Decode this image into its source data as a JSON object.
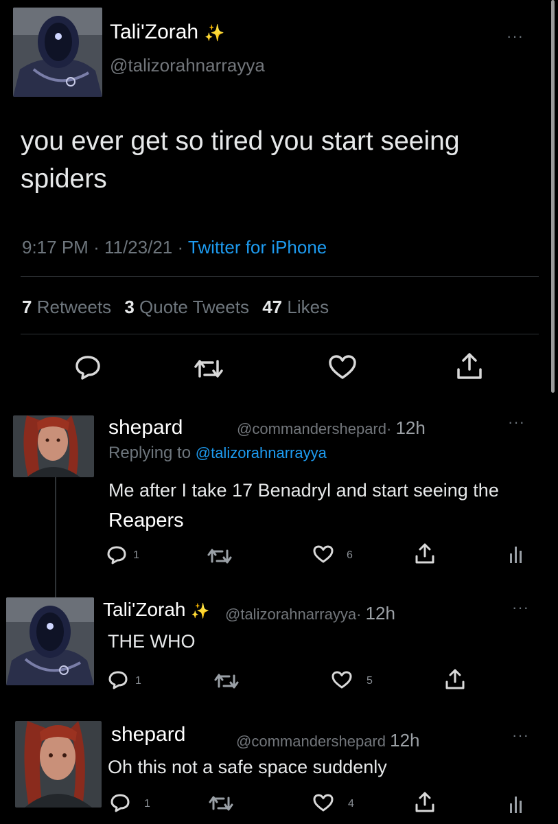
{
  "main_tweet": {
    "author_name": "Tali'Zorah",
    "author_emoji": "✨",
    "author_handle": "@talizorahnarrayya",
    "text": "you ever get so tired you start seeing spiders",
    "time": "9:17 PM",
    "date": "11/23/21",
    "source": "Twitter for iPhone",
    "retweets_count": "7",
    "retweets_label": "Retweets",
    "quotes_count": "3",
    "quotes_label": "Quote Tweets",
    "likes_count": "47",
    "likes_label": "Likes"
  },
  "replies": [
    {
      "author_name": "shepard",
      "author_handle": "@commandershepard",
      "age": "12h",
      "replying_label": "Replying to",
      "replying_handle": "@talizorahnarrayya",
      "text_before": "Me after I take 17 Benadryl and start seeing the ",
      "text_highlight": "Reapers",
      "reply_count": "1",
      "like_count": "6"
    },
    {
      "author_name": "Tali'Zorah",
      "author_emoji": "✨",
      "author_handle": "@talizorahnarrayya",
      "age": "12h",
      "text": "THE WHO",
      "reply_count": "1",
      "like_count": "5"
    },
    {
      "author_name": "shepard",
      "author_handle": "@commandershepard",
      "age": "12h",
      "text": "Oh this not a safe space suddenly",
      "reply_count": "1",
      "like_count": "4"
    }
  ],
  "icons": {
    "reply": "reply-icon",
    "retweet": "retweet-icon",
    "like": "heart-icon",
    "share": "share-icon",
    "analytics": "analytics-icon",
    "more": "more-icon"
  },
  "colors": {
    "background": "#000000",
    "link": "#1d9bf0",
    "secondary_text": "#6e767d"
  },
  "more_glyph": "···",
  "dot_separator": "·"
}
